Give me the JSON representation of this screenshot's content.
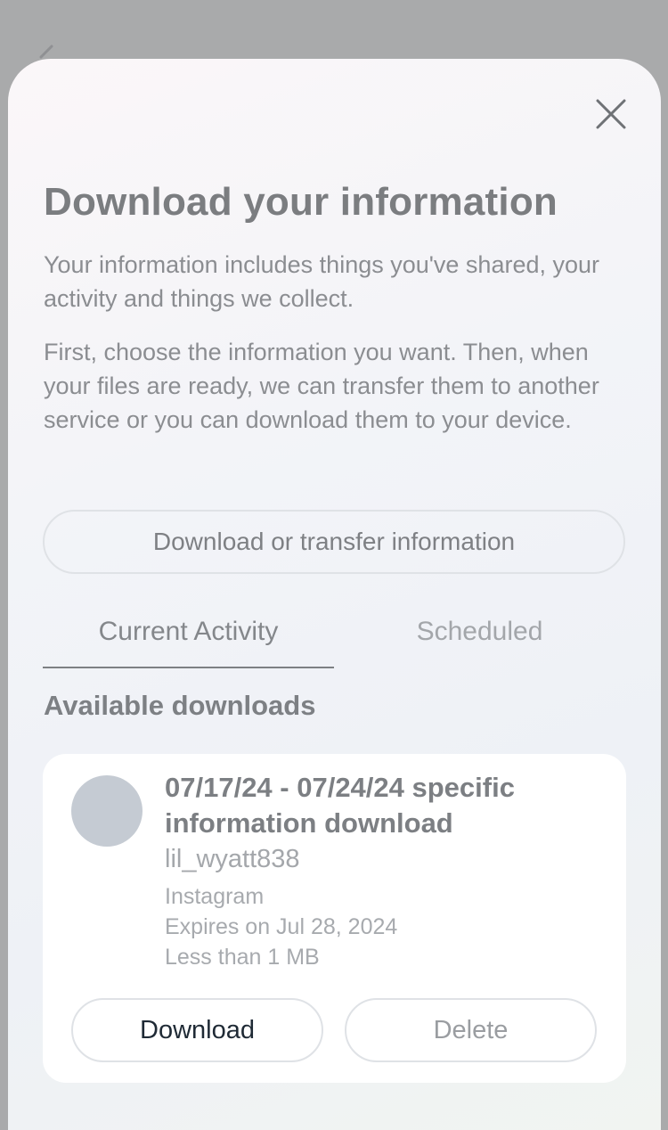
{
  "sheet": {
    "title": "Download your information",
    "intro": "Your information includes things you've shared, your activity and things we collect.",
    "instructions": "First, choose the information you want. Then, when your files are ready, we can transfer them to another service or you can download them to your device.",
    "transfer_button": "Download or transfer information",
    "close_icon": "close-icon"
  },
  "tabs": [
    {
      "label": "Current Activity",
      "active": true
    },
    {
      "label": "Scheduled",
      "active": false
    }
  ],
  "downloads": {
    "section_title": "Available downloads",
    "items": [
      {
        "title": "07/17/24 - 07/24/24 specific information download",
        "username": "lil_wyatt838",
        "app": "Instagram",
        "expires": "Expires on Jul 28, 2024",
        "size": "Less than 1 MB",
        "download_label": "Download",
        "delete_label": "Delete"
      }
    ]
  }
}
